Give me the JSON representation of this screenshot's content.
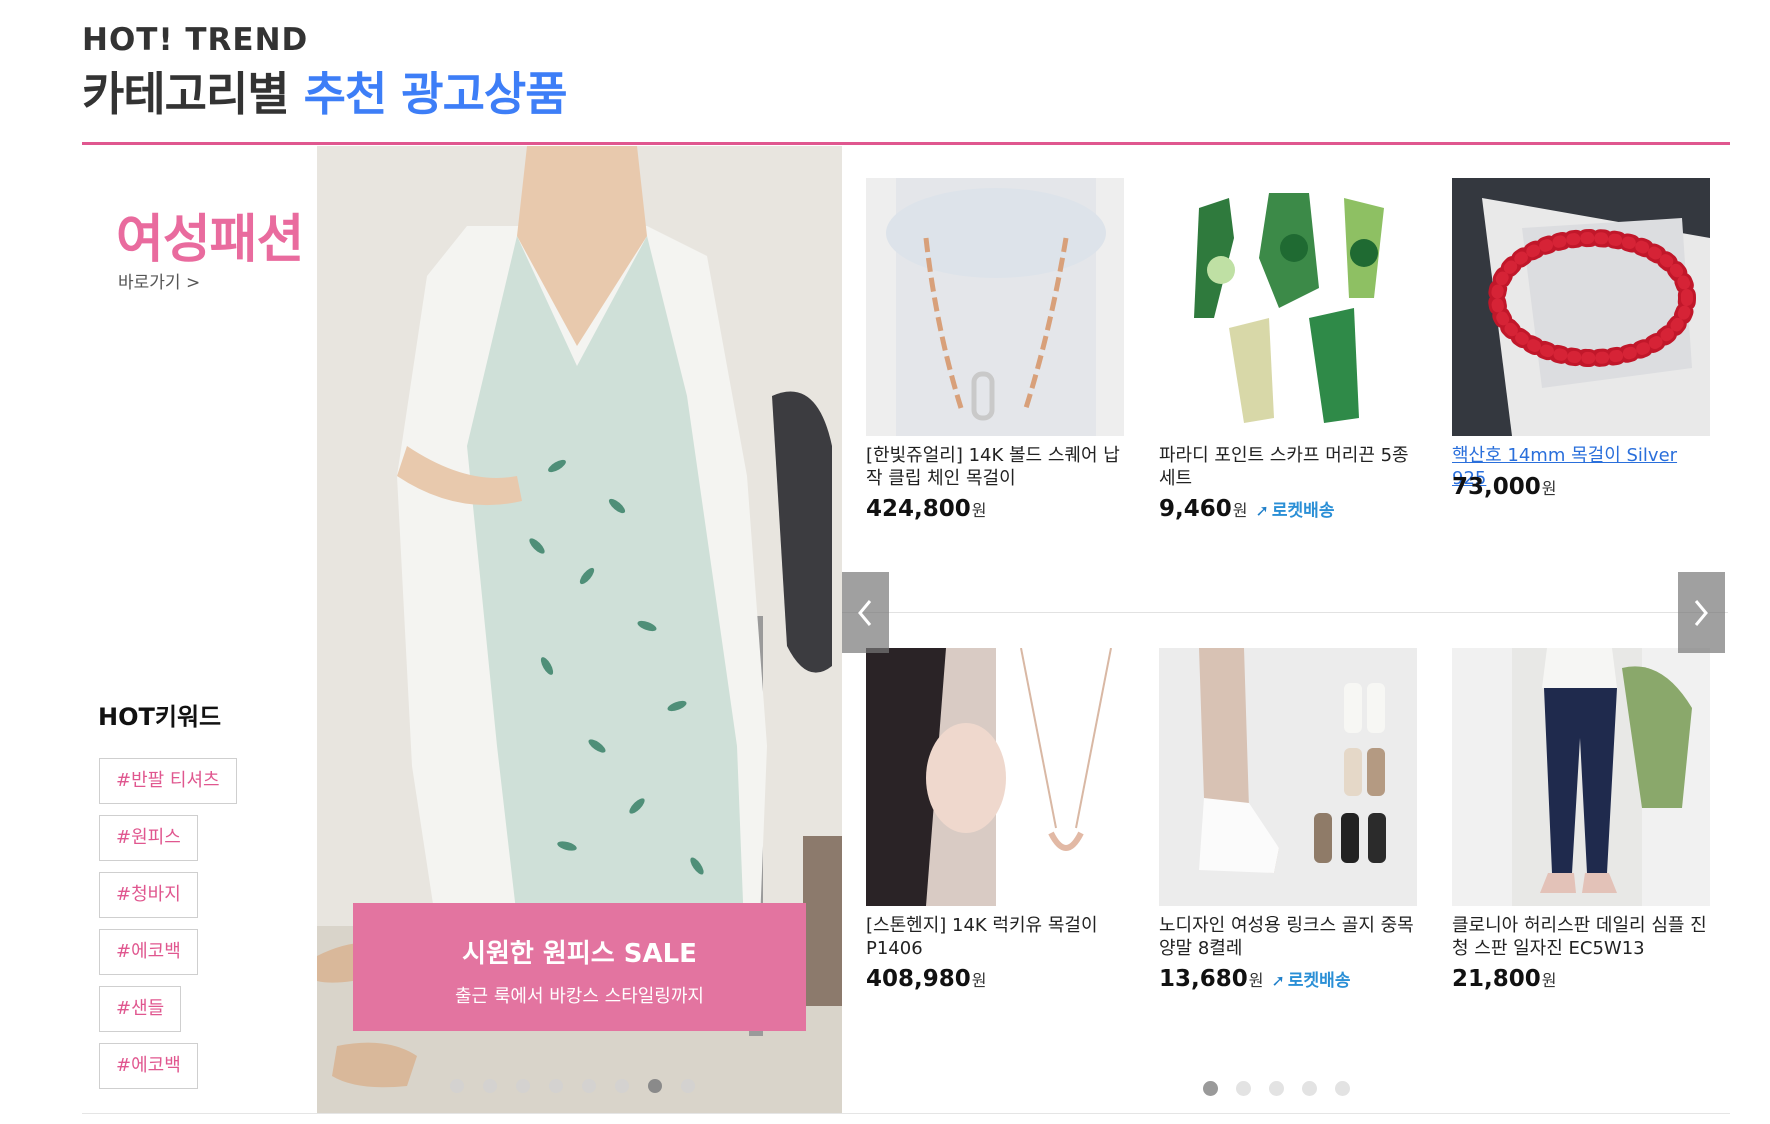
{
  "header": {
    "subtitle": "HOT! TREND",
    "title_plain": "카테고리별",
    "title_accent": "추천 광고상품"
  },
  "category": {
    "title": "여성패션",
    "link": "바로가기 >"
  },
  "keywords": {
    "title": "HOT키워드",
    "items": [
      "#반팔 티셔츠",
      "#원피스",
      "#청바지",
      "#에코백",
      "#샌들",
      "#에코백"
    ]
  },
  "banner": {
    "title": "시원한 원피스 SALE",
    "subtitle": "출근 룩에서 바캉스 스타일링까지",
    "dot_count": 8,
    "active_dot": 6
  },
  "products": [
    {
      "name": "[한빛쥬얼리] 14K 볼드 스퀘어 납작 클립 체인 목걸이",
      "price": "424,800",
      "currency": "원",
      "rocket": "",
      "link_style": false,
      "image": "gold-chain-necklace"
    },
    {
      "name": "파라디 포인트 스카프 머리끈 5종 세트",
      "price": "9,460",
      "currency": "원",
      "rocket": "로켓배송",
      "link_style": false,
      "image": "green-scarf-set"
    },
    {
      "name": "핵산호 14mm 목걸이 Silver 925",
      "price": "73,000",
      "currency": "원",
      "rocket": "",
      "link_style": true,
      "image": "red-coral-necklace"
    },
    {
      "name": "[스톤헨지] 14K 럭키유 목걸이 P1406",
      "price": "408,980",
      "currency": "원",
      "rocket": "",
      "link_style": false,
      "image": "horseshoe-pendant-necklace"
    },
    {
      "name": "노디자인 여성용 링크스 골지 중목 양말 8켤레",
      "price": "13,680",
      "currency": "원",
      "rocket": "로켓배송",
      "link_style": false,
      "image": "ribbed-socks"
    },
    {
      "name": "클로니아 허리스판 데일리 심플 진청 스판 일자진 EC5W13",
      "price": "21,800",
      "currency": "원",
      "rocket": "",
      "link_style": false,
      "image": "dark-denim-jeans"
    }
  ],
  "pager": {
    "dot_count": 5,
    "active_dot": 0
  },
  "colors": {
    "accent_pink": "#e0578f",
    "accent_blue": "#3d7ef7",
    "rocket_blue": "#2a8fd6"
  }
}
